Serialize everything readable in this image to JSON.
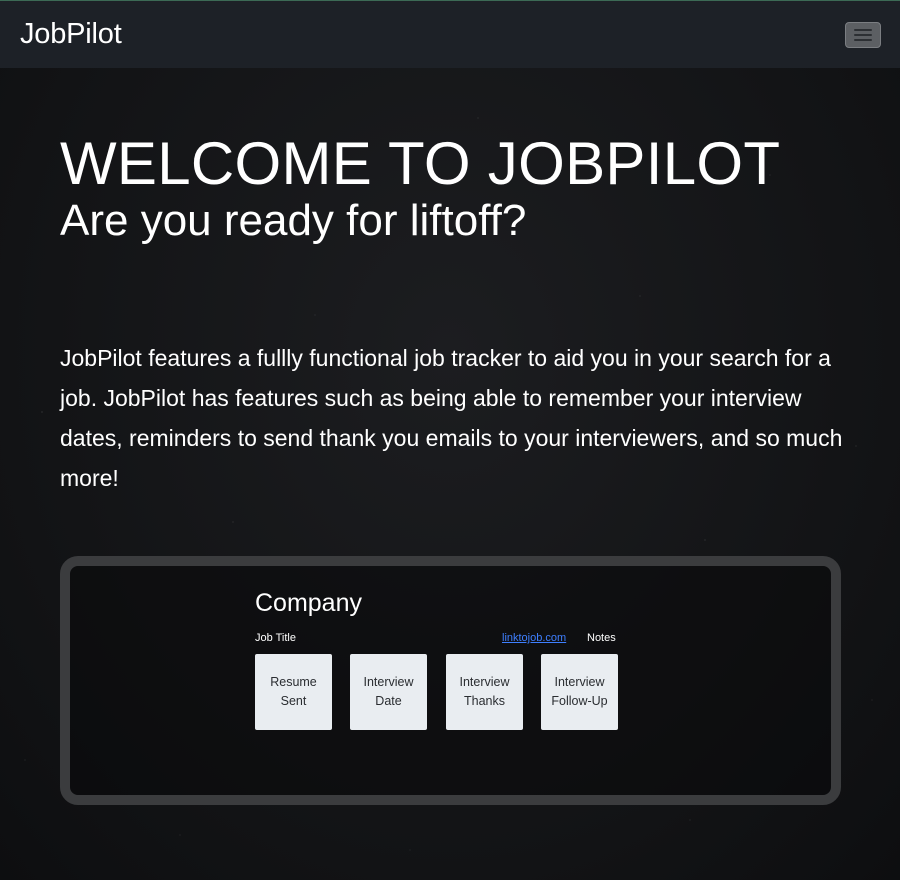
{
  "navbar": {
    "brand": "JobPilot",
    "toggle_icon": "hamburger-menu-icon"
  },
  "hero": {
    "title": "WELCOME TO JOBPILOT",
    "subtitle": "Are you ready for liftoff?",
    "description": "JobPilot features a fullly functional job tracker to aid you in your search for a job. JobPilot has features such as being able to remember your interview dates, reminders to send thank you emails to your interviewers, and so much more!"
  },
  "example_card": {
    "company": "Company",
    "job_title": "Job Title",
    "link": "linktojob.com",
    "notes": "Notes",
    "steps": [
      {
        "line1": "Resume",
        "line2": "Sent"
      },
      {
        "line1": "Interview",
        "line2": "Date"
      },
      {
        "line1": "Interview",
        "line2": "Thanks"
      },
      {
        "line1": "Interview",
        "line2": "Follow-Up"
      }
    ]
  },
  "colors": {
    "navbar_bg": "#1d2127",
    "page_bg": "#151618",
    "card_border": "#3b3c3e",
    "step_bg": "#e9edf1",
    "link": "#3e7fff"
  }
}
